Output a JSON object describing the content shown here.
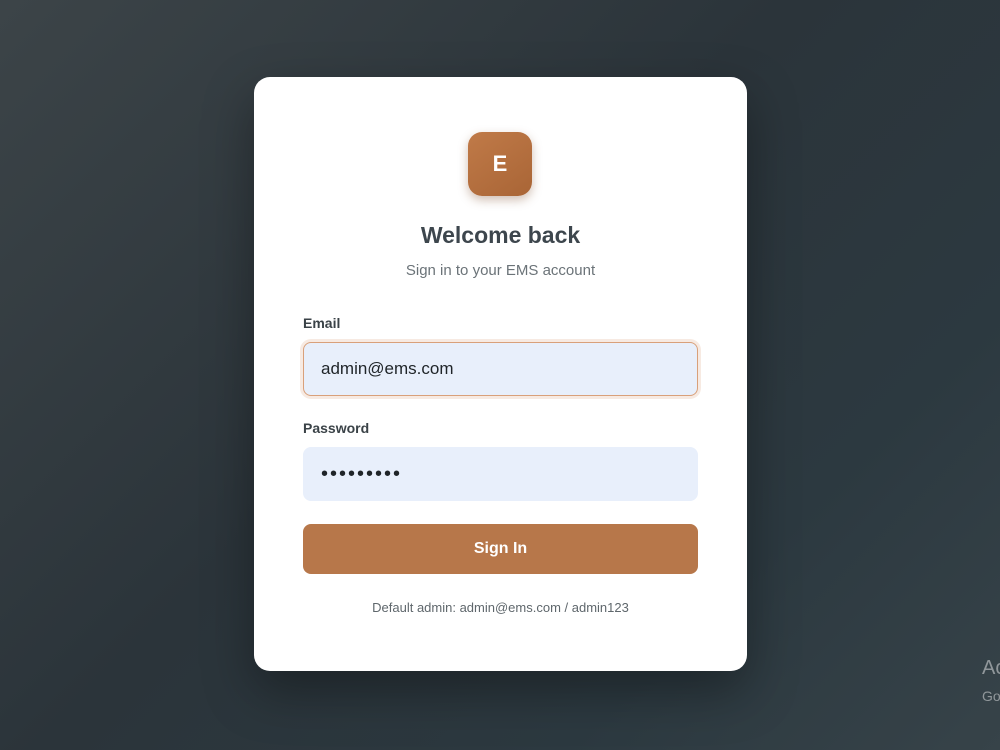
{
  "app": {
    "logo_letter": "E",
    "brand_color": "#b7774a"
  },
  "login": {
    "title": "Welcome back",
    "subtitle": "Sign in to your EMS account",
    "email_label": "Email",
    "email_value": "admin@ems.com",
    "password_label": "Password",
    "password_value": "•••••••••",
    "submit_label": "Sign In",
    "hint": "Default admin: admin@ems.com / admin123"
  },
  "watermark": {
    "line1": "Ac",
    "line2": "Go"
  }
}
